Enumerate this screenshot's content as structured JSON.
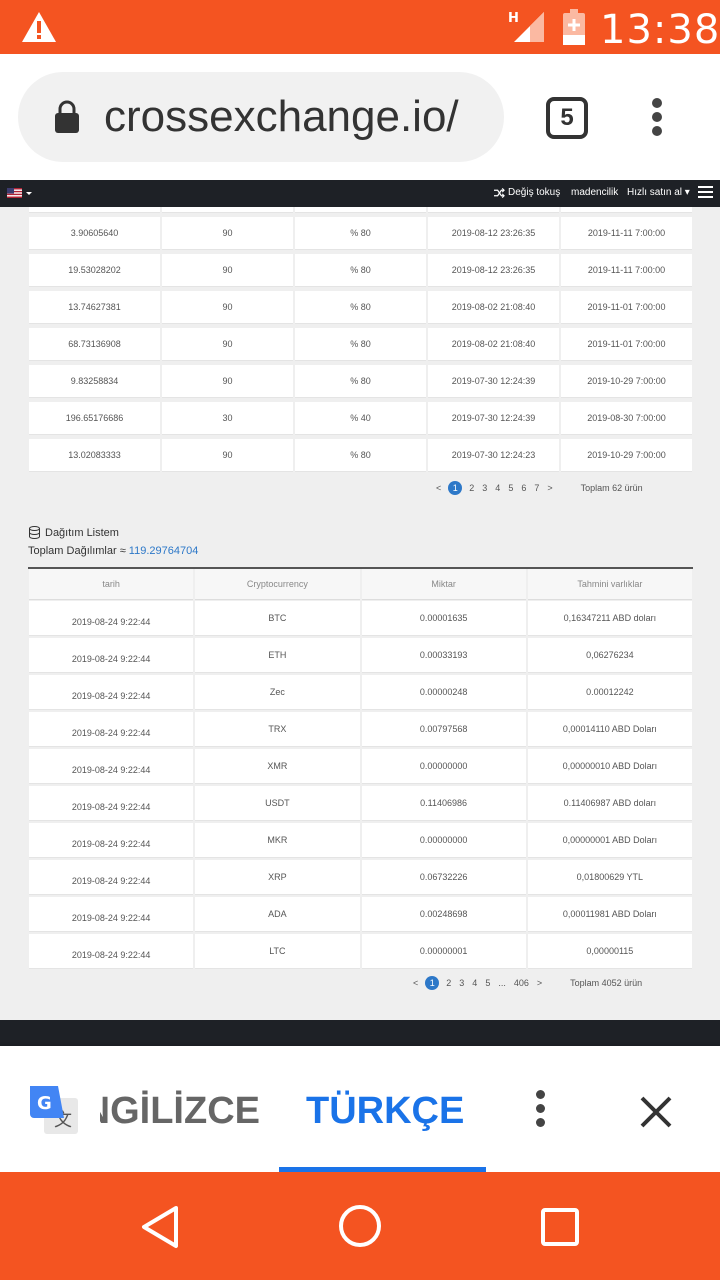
{
  "status_bar": {
    "network": "H",
    "time": "13:38",
    "warning_icon": "warning-triangle-icon"
  },
  "browser": {
    "url": "crossexchange.io/",
    "tab_count": "5"
  },
  "site_nav": {
    "flag": "us-flag-icon",
    "items": [
      "Değiş tokuş",
      "madencilik",
      "Hızlı satın al"
    ]
  },
  "table1": {
    "rows": [
      [
        "3.90605640",
        "90",
        "% 80",
        "2019-08-12 23:26:35",
        "2019-11-11 7:00:00"
      ],
      [
        "19.53028202",
        "90",
        "% 80",
        "2019-08-12 23:26:35",
        "2019-11-11 7:00:00"
      ],
      [
        "13.74627381",
        "90",
        "% 80",
        "2019-08-02 21:08:40",
        "2019-11-01 7:00:00"
      ],
      [
        "68.73136908",
        "90",
        "% 80",
        "2019-08-02 21:08:40",
        "2019-11-01 7:00:00"
      ],
      [
        "9.83258834",
        "90",
        "% 80",
        "2019-07-30 12:24:39",
        "2019-10-29 7:00:00"
      ],
      [
        "196.65176686",
        "30",
        "% 40",
        "2019-07-30 12:24:39",
        "2019-08-30 7:00:00"
      ],
      [
        "13.02083333",
        "90",
        "% 80",
        "2019-07-30 12:24:23",
        "2019-10-29 7:00:00"
      ]
    ],
    "pager": {
      "prev": "<",
      "pages": [
        "1",
        "2",
        "3",
        "4",
        "5",
        "6",
        "7"
      ],
      "next": ">",
      "total": "Toplam 62 ürün"
    }
  },
  "distribution": {
    "title": "Dağıtım Listem",
    "total_label": "Toplam Dağılımlar ≈ ",
    "total_value": "119.29764704",
    "headers": [
      "tarih",
      "Cryptocurrency",
      "Miktar",
      "Tahmini varlıklar"
    ],
    "rows": [
      [
        "2019-08-24 9:22:44",
        "BTC",
        "0.00001635",
        "0,16347211 ABD doları"
      ],
      [
        "2019-08-24 9:22:44",
        "ETH",
        "0.00033193",
        "0,06276234"
      ],
      [
        "2019-08-24 9:22:44",
        "Zec",
        "0.00000248",
        "0.00012242"
      ],
      [
        "2019-08-24 9:22:44",
        "TRX",
        "0.00797568",
        "0,00014110 ABD Doları"
      ],
      [
        "2019-08-24 9:22:44",
        "XMR",
        "0.00000000",
        "0,00000010 ABD Doları"
      ],
      [
        "2019-08-24 9:22:44",
        "USDT",
        "0.11406986",
        "0.11406987 ABD doları"
      ],
      [
        "2019-08-24 9:22:44",
        "MKR",
        "0.00000000",
        "0,00000001 ABD Doları"
      ],
      [
        "2019-08-24 9:22:44",
        "XRP",
        "0.06732226",
        "0,01800629 YTL"
      ],
      [
        "2019-08-24 9:22:44",
        "ADA",
        "0.00248698",
        "0,00011981 ABD Doları"
      ],
      [
        "2019-08-24 9:22:44",
        "LTC",
        "0.00000001",
        "0,00000115"
      ]
    ],
    "pager": {
      "prev": "<",
      "pages": [
        "1",
        "2",
        "3",
        "4",
        "5"
      ],
      "ellipsis": "...",
      "last": "406",
      "next": ">",
      "total": "Toplam 4052 ürün"
    }
  },
  "translate_bar": {
    "source_lang": "İNGİLİZCE",
    "target_lang": "TÜRKÇE"
  },
  "colors": {
    "accent_orange": "#f45421",
    "link_blue": "#2d78c8",
    "translate_blue": "#1a73e8",
    "dark_nav": "#1e2126"
  }
}
